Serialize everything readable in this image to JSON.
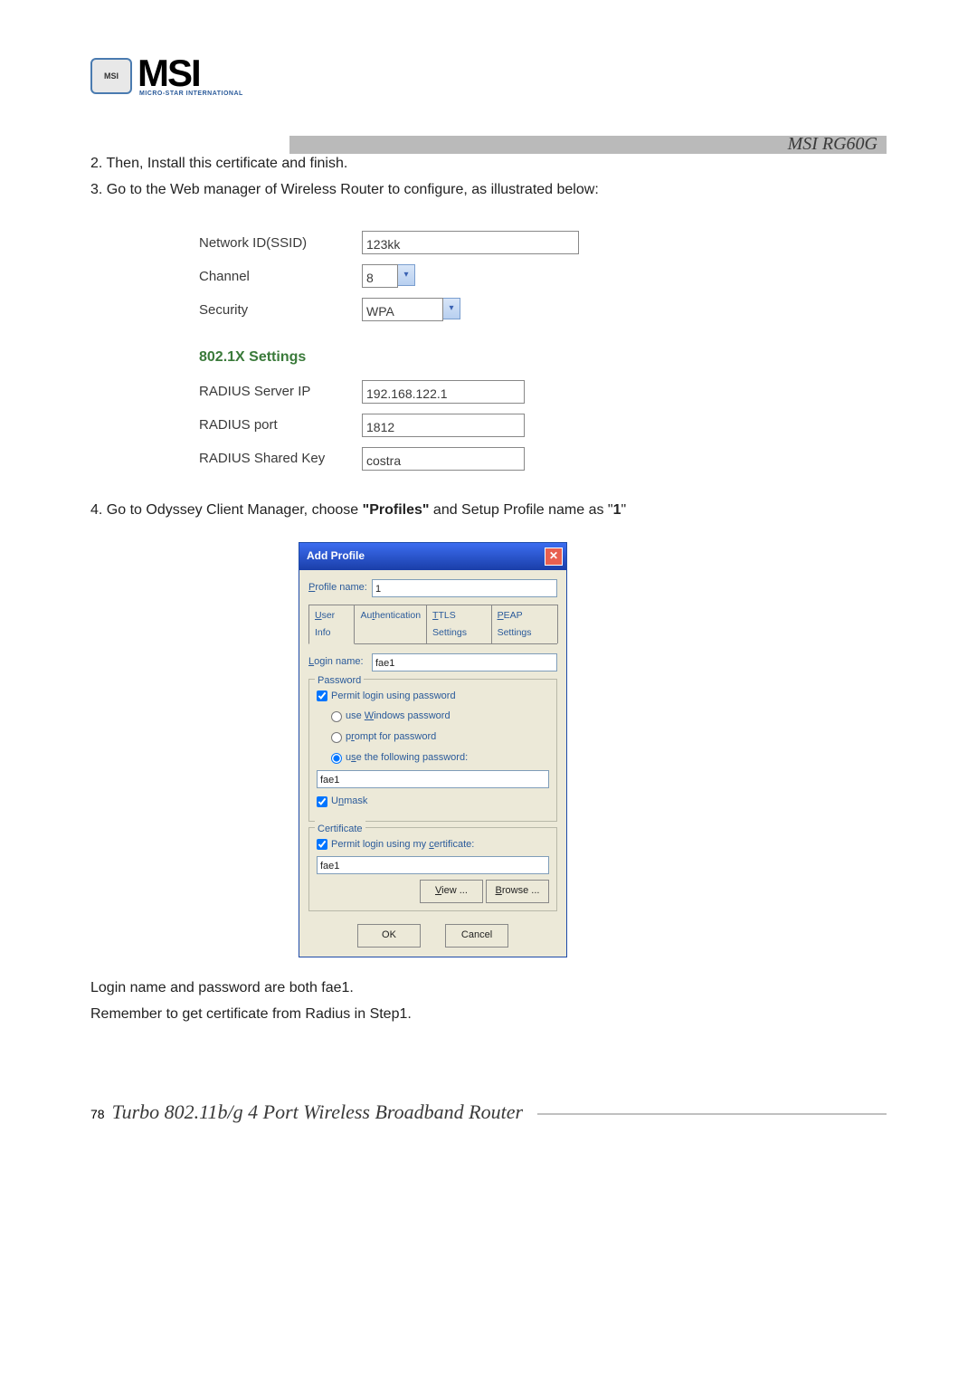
{
  "header": {
    "logo_badge": "MSI",
    "logo_text": "MSI",
    "logo_sub": "MICRO-STAR INTERNATIONAL",
    "model": "MSI RG60G"
  },
  "body": {
    "step2": "2. Then, Install this certificate and finish.",
    "step3": "3. Go to the Web manager of Wireless Router to configure, as illustrated below:",
    "form": {
      "ssid_label": "Network ID(SSID)",
      "ssid_value": "123kk",
      "channel_label": "Channel",
      "channel_value": "8",
      "security_label": "Security",
      "security_value": "WPA",
      "section": "802.1X Settings",
      "radius_ip_label": "RADIUS Server IP",
      "radius_ip_value": "192.168.122.1",
      "radius_port_label": "RADIUS port",
      "radius_port_value": "1812",
      "radius_key_label": "RADIUS Shared Key",
      "radius_key_value": "costra"
    },
    "step4_a": "4. Go to Odyssey Client Manager, choose ",
    "step4_b": "\"Profiles\"",
    "step4_c": " and Setup Profile name as \"",
    "step4_d": "1",
    "step4_e": "\"",
    "dialog": {
      "title": "Add Profile",
      "profile_name_label": "Profile name:",
      "profile_name_value": "1",
      "tabs": [
        "User Info",
        "Authentication",
        "TTLS Settings",
        "PEAP Settings"
      ],
      "login_label": "Login name:",
      "login_value": "fae1",
      "password_legend": "Password",
      "permit_pw": "Permit login using password",
      "use_windows": "use Windows password",
      "prompt_pw": "prompt for password",
      "use_following": "use the following password:",
      "pw_value": "fae1",
      "unmask": "Unmask",
      "cert_legend": "Certificate",
      "permit_cert": "Permit login using my certificate:",
      "cert_value": "fae1",
      "view_btn": "View ...",
      "browse_btn": "Browse ...",
      "ok_btn": "OK",
      "cancel_btn": "Cancel"
    },
    "note1": "Login name and password are both fae1.",
    "note2": "Remember to get certificate from Radius in Step1."
  },
  "footer": {
    "page": "78",
    "title": "Turbo 802.11b/g 4 Port Wireless Broadband Router"
  }
}
